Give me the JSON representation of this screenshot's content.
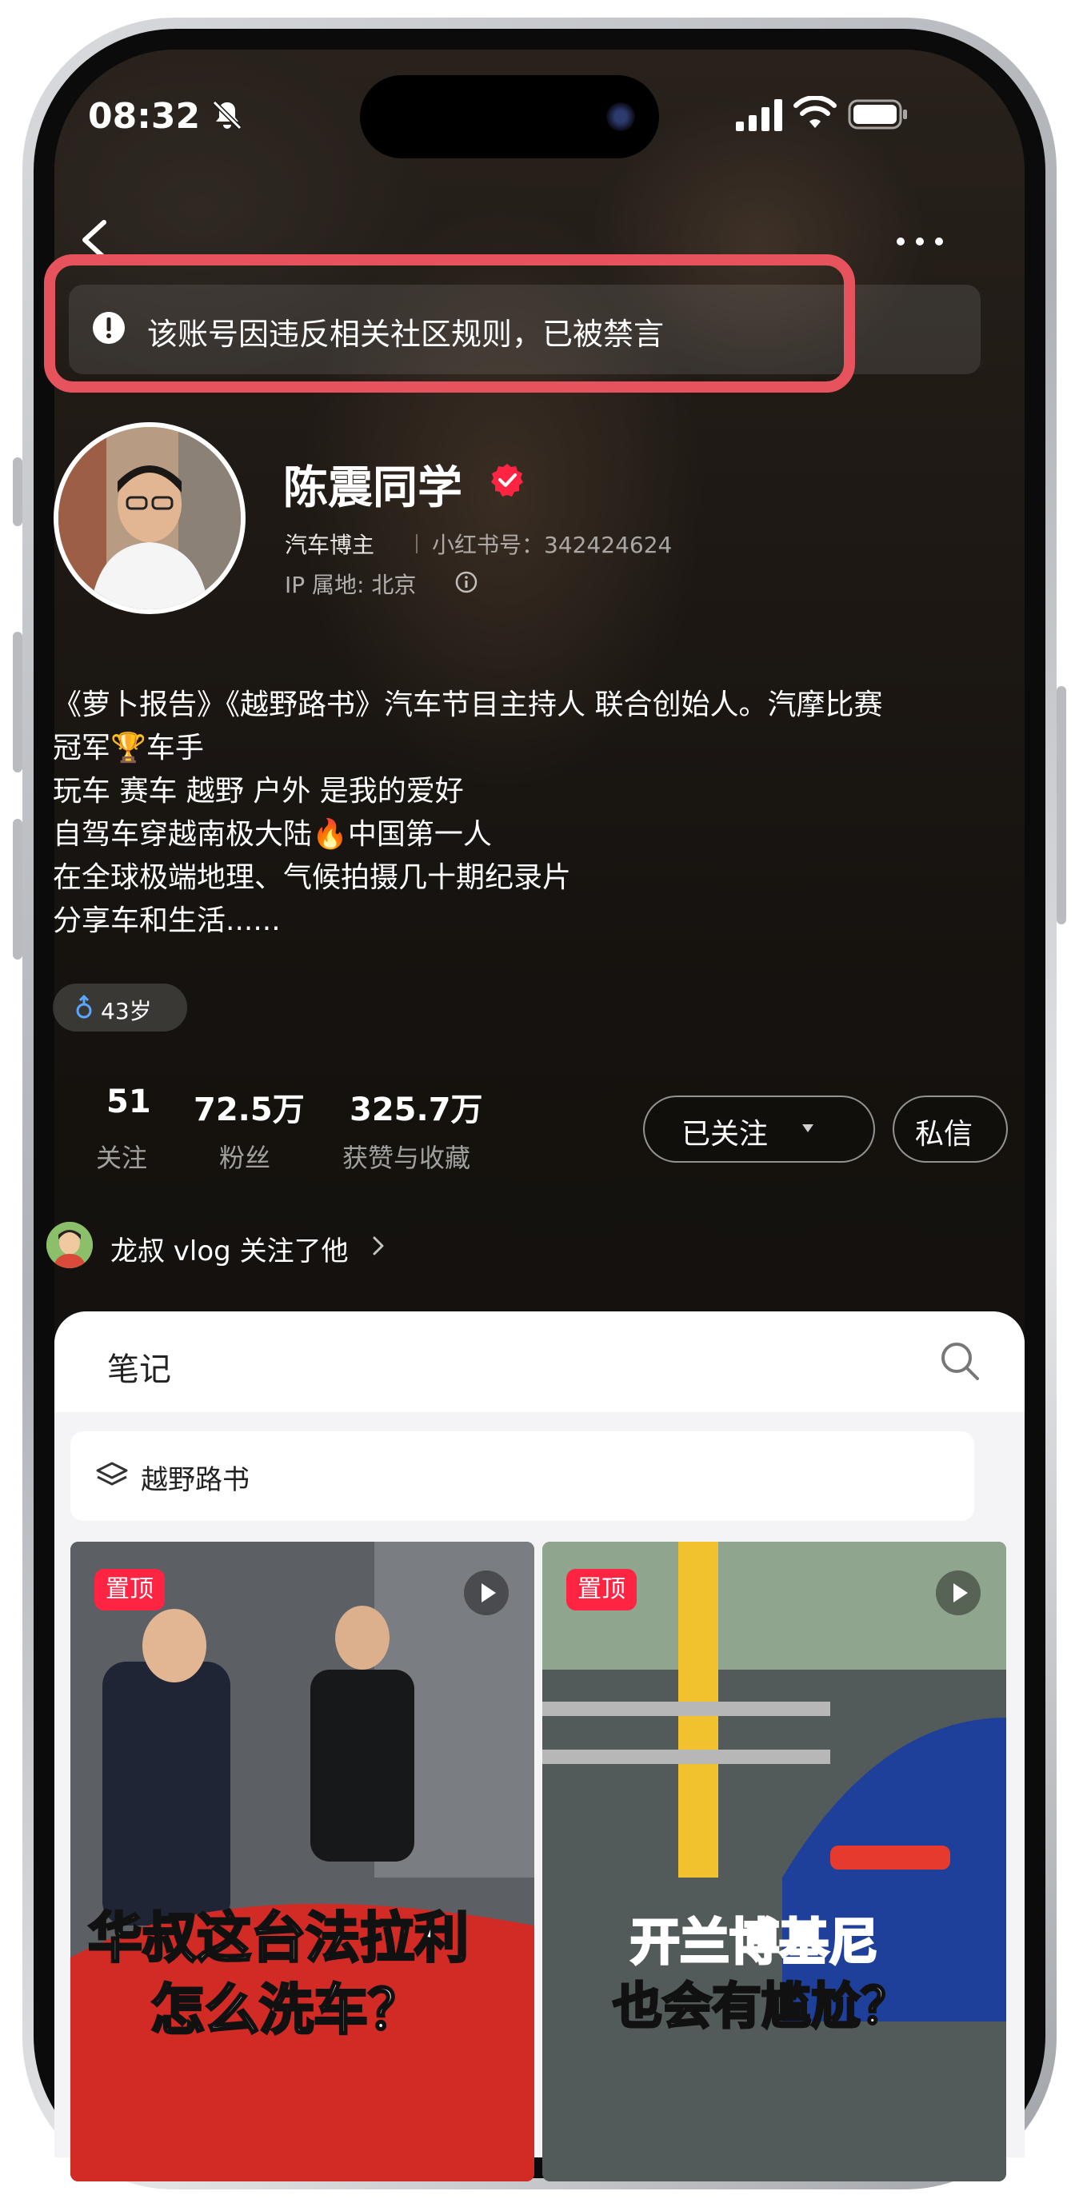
{
  "status_bar": {
    "time": "08:32"
  },
  "ban_notice": {
    "text": "该账号因违反相关社区规则，已被禁言"
  },
  "profile": {
    "name": "陈震同学",
    "role": "汽车博主",
    "red_id": "小红书号：342424624",
    "ip_location": "IP 属地: 北京",
    "bio_lines": [
      "《萝卜报告》《越野路书》汽车节目主持人 联合创始人。汽摩比赛",
      "冠军🏆车手",
      "玩车 赛车 越野 户外 是我的爱好",
      "自驾车穿越南极大陆🔥中国第一人",
      "在全球极端地理、气候拍摄几十期纪录片",
      "分享车和生活......"
    ],
    "age_tag": "43岁",
    "stats": [
      {
        "value": "51",
        "label": "关注"
      },
      {
        "value": "72.5万",
        "label": "粉丝"
      },
      {
        "value": "325.7万",
        "label": "获赞与收藏"
      }
    ],
    "follow_button": "已关注",
    "message_button": "私信",
    "mutual_follow": "龙叔 vlog 关注了他"
  },
  "notes": {
    "tab_title": "笔记",
    "collection": "越野路书",
    "cards": [
      {
        "pin": "置顶",
        "caption_line1": "华叔这台法拉利",
        "caption_line2": "怎么洗车？"
      },
      {
        "pin": "置顶",
        "caption_line1": "开兰博基尼",
        "caption_line2": "也会有尴尬？"
      }
    ]
  },
  "colors": {
    "ban_highlight": "#e6535d",
    "brand_red": "#ff2442",
    "caption_red": "#ff2a3a"
  },
  "icons": [
    "back-arrow-icon",
    "more-icon",
    "exclamation-icon",
    "verified-icon",
    "info-icon",
    "male-icon",
    "caret-down-icon",
    "chevron-right-icon",
    "search-icon",
    "layers-icon",
    "play-icon",
    "bell-slash-icon",
    "signal-icon",
    "wifi-icon",
    "battery-icon"
  ]
}
